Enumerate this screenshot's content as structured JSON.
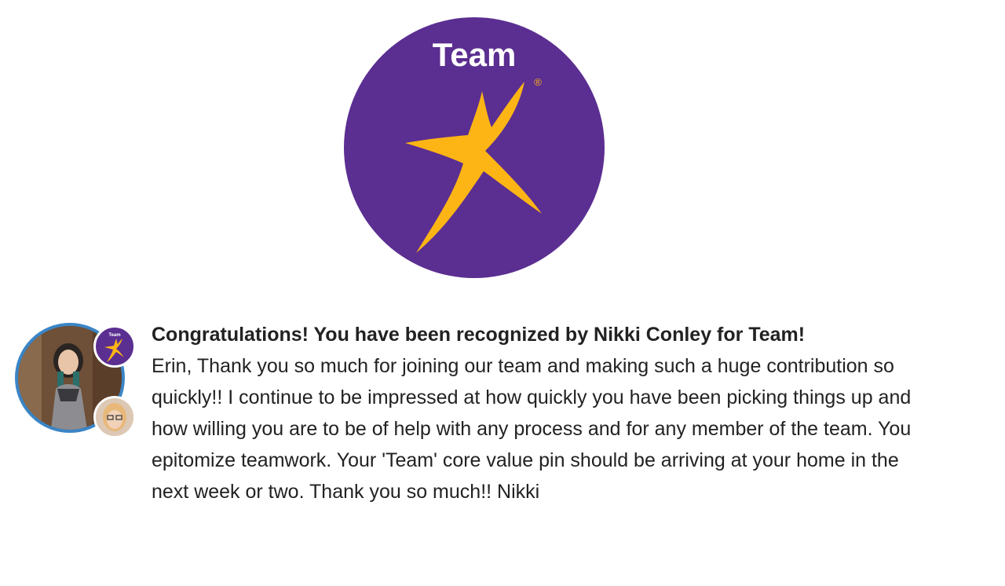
{
  "badge": {
    "name": "Team",
    "registered_mark": "®",
    "icon": "star-icon",
    "colors": {
      "background": "#5b2e91",
      "star": "#fdb515",
      "text": "#ffffff"
    }
  },
  "avatars": {
    "recipient": "recipient-avatar",
    "giver": "giver-avatar",
    "ring_color": "#3a85c6"
  },
  "recognition": {
    "headline": "Congratulations! You have been recognized by Nikki Conley for Team!",
    "message": "Erin, Thank you so much for joining our team and making such a huge contribution so quickly!! I continue to be impressed at how quickly you have been picking things up and how willing you are to be of help with any process and for any member of the team. You epitomize teamwork. Your 'Team' core value pin should be arriving at your home in the next week or two. Thank you so much!! Nikki"
  }
}
